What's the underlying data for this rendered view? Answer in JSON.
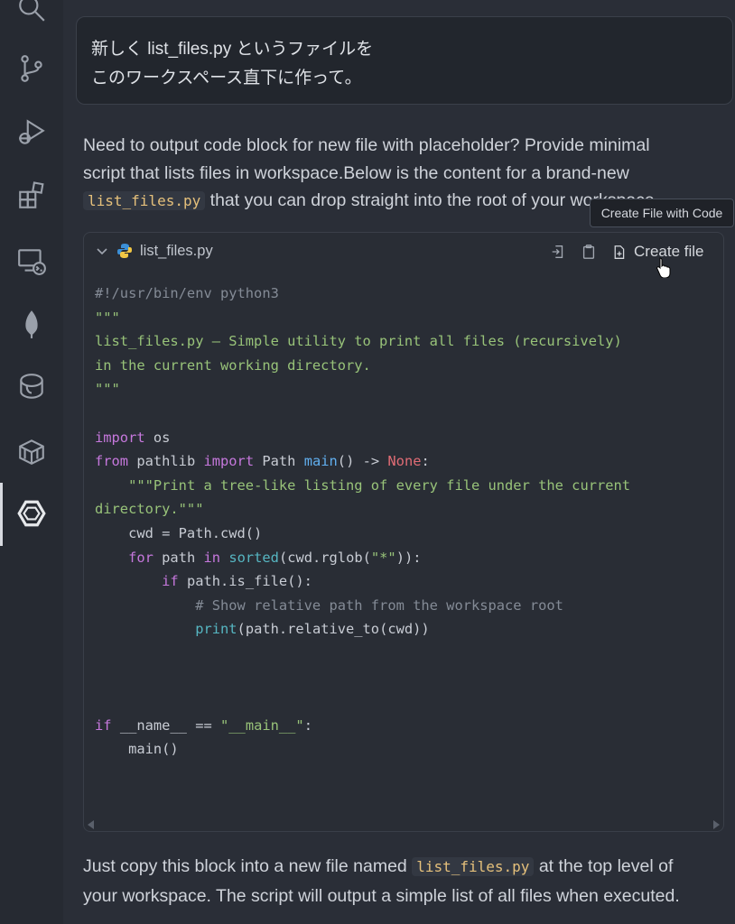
{
  "activity_bar": {
    "icons": [
      "search-icon",
      "source-control-icon",
      "run-debug-icon",
      "extensions-icon",
      "remote-explorer-icon",
      "leaf-icon",
      "database-icon",
      "container-icon",
      "ai-assistant-icon"
    ]
  },
  "user_message": {
    "lines": [
      "新しく list_files.py というファイルを",
      "このワークスペース直下に作って。"
    ]
  },
  "answer": {
    "line1": "Need to output code block for new file with placeholder? Provide minimal",
    "line2": "script that lists files in workspace.Below is the content for a brand-new",
    "line3_code": "list_files.py",
    "line3_text": " that you can drop straight into the root of your workspace."
  },
  "tooltip": "Create File with Code",
  "code_block": {
    "file_name": "list_files.py",
    "create_file_label": "Create file",
    "lines": {
      "shebang": "#!/usr/bin/env python3",
      "doc_open": "\"\"\"",
      "doc1": "list_files.py – Simple utility to print all files (recursively)",
      "doc2": "in the current working directory.",
      "doc_close": "\"\"\"",
      "kw_import": "import",
      "mod_os": " os",
      "kw_from": "from",
      "mod_pathlib": " pathlib ",
      "kw_import2": "import",
      "cls_path": " Path",
      "kw_def": "def",
      "fn_main": "main",
      "sig": "() -> ",
      "none": "None",
      "colon": ":",
      "indent4": "    ",
      "docstr1": "\"\"\"Print a tree-like listing of every file under the current",
      "docstr2": "directory.\"\"\"",
      "cwd_line": "    cwd = Path.cwd()",
      "kw_for": "for",
      "for_mid": " path ",
      "kw_in": "in",
      "sp": " ",
      "bi_sorted": "sorted",
      "for_args1": "(cwd.rglob(",
      "glob_str": "\"*\"",
      "for_args2": ")):",
      "indent8": "        ",
      "kw_if": "if",
      "if_cond": " path.is_file():",
      "indent12": "            ",
      "comment": "# Show relative path from the workspace root",
      "bi_print": "print",
      "print_args": "(path.relative_to(cwd))",
      "kw_if2": "if",
      "main_guard": " __name__ == ",
      "main_str": "\"__main__\"",
      "colon2": ":",
      "main_call": "    main()"
    }
  },
  "footer": {
    "line1_pre": "Just copy this block into a new file named ",
    "line1_code": "list_files.py",
    "line1_post": " at the top level of",
    "line2": "your workspace. The script will output a simple list of all files when executed."
  },
  "colors": {
    "background": "#2a2e37",
    "keyword": "#c678dd",
    "string": "#98c379",
    "function": "#61afef",
    "builtin": "#56b6c2",
    "comment": "#848b96",
    "none": "#e06c75"
  }
}
